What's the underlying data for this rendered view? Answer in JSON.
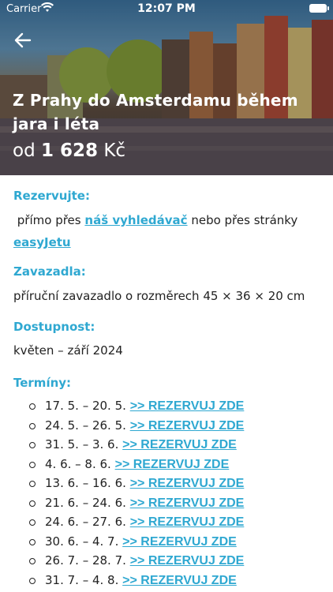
{
  "status_bar": {
    "carrier": "Carrier",
    "time": "12:07 PM"
  },
  "hero": {
    "title": "Z Prahy do Amsterdamu během jara i léta",
    "price_prefix": "od",
    "price_value": "1 628",
    "price_currency": "Kč"
  },
  "sections": {
    "rezervujte_label": "Rezervujte:",
    "rezervujte_text_1": "přímo přes",
    "rezervujte_link_1": "náš vyhledávač",
    "rezervujte_text_2": "nebo přes stránky",
    "rezervujte_link_2": "easyJetu",
    "zavazadla_label": "Zavazadla:",
    "zavazadla_text": "příruční zavazadlo o rozměrech 45 × 36 × 20 cm",
    "dostupnost_label": "Dostupnost:",
    "dostupnost_text": "květen – září 2024",
    "terminy_label": "Termíny:"
  },
  "terms": [
    {
      "dates": "17. 5. – 20. 5.",
      "link": ">> REZERVUJ ZDE"
    },
    {
      "dates": "24. 5. – 26. 5.",
      "link": ">> REZERVUJ ZDE"
    },
    {
      "dates": "31. 5. – 3. 6.",
      "link": ">> REZERVUJ ZDE"
    },
    {
      "dates": "4. 6. – 8. 6.",
      "link": ">> REZERVUJ ZDE"
    },
    {
      "dates": "13. 6. – 16. 6.",
      "link": ">> REZERVUJ ZDE"
    },
    {
      "dates": "21. 6. – 24. 6.",
      "link": ">> REZERVUJ ZDE"
    },
    {
      "dates": "24. 6. – 27. 6.",
      "link": ">> REZERVUJ ZDE"
    },
    {
      "dates": "30. 6. – 4. 7.",
      "link": ">> REZERVUJ ZDE"
    },
    {
      "dates": "26. 7. – 28. 7.",
      "link": ">> REZERVUJ ZDE"
    },
    {
      "dates": "31. 7. – 4. 8.",
      "link": ">> REZERVUJ ZDE"
    }
  ],
  "colors": {
    "accent": "#2fa8d1",
    "text": "#222222"
  },
  "icons": {
    "back": "arrow-left-icon",
    "wifi": "wifi-icon",
    "battery": "battery-icon"
  }
}
